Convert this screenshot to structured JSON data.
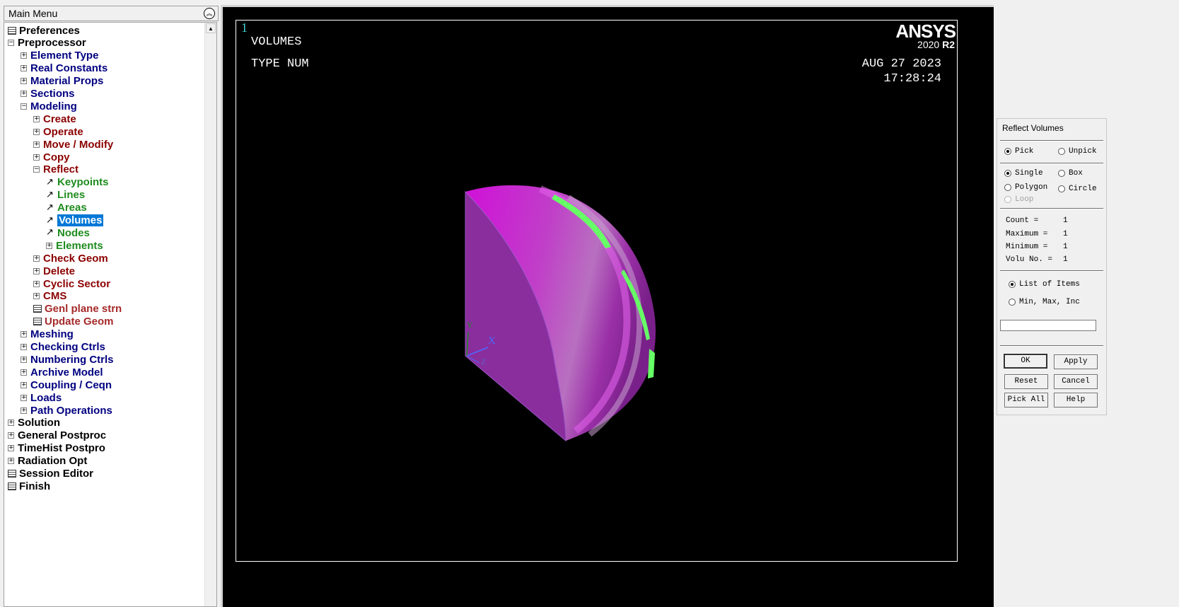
{
  "menu": {
    "title": "Main Menu",
    "items": [
      {
        "label": "Preferences",
        "level": 0,
        "icon": "calc",
        "color": "black"
      },
      {
        "label": "Preprocessor",
        "level": 0,
        "icon": "minus",
        "color": "black"
      },
      {
        "label": "Element Type",
        "level": 1,
        "icon": "plus",
        "color": "blue"
      },
      {
        "label": "Real Constants",
        "level": 1,
        "icon": "plus",
        "color": "blue"
      },
      {
        "label": "Material Props",
        "level": 1,
        "icon": "plus",
        "color": "blue"
      },
      {
        "label": "Sections",
        "level": 1,
        "icon": "plus",
        "color": "blue"
      },
      {
        "label": "Modeling",
        "level": 1,
        "icon": "minus",
        "color": "blue"
      },
      {
        "label": "Create",
        "level": 2,
        "icon": "plus",
        "color": "red"
      },
      {
        "label": "Operate",
        "level": 2,
        "icon": "plus",
        "color": "red"
      },
      {
        "label": "Move / Modify",
        "level": 2,
        "icon": "plus",
        "color": "red"
      },
      {
        "label": "Copy",
        "level": 2,
        "icon": "plus",
        "color": "red"
      },
      {
        "label": "Reflect",
        "level": 2,
        "icon": "minus",
        "color": "red"
      },
      {
        "label": "Keypoints",
        "level": 3,
        "icon": "arrow",
        "color": "green"
      },
      {
        "label": "Lines",
        "level": 3,
        "icon": "arrow",
        "color": "green"
      },
      {
        "label": "Areas",
        "level": 3,
        "icon": "arrow",
        "color": "green"
      },
      {
        "label": "Volumes",
        "level": 3,
        "icon": "arrow",
        "color": "green",
        "selected": true
      },
      {
        "label": "Nodes",
        "level": 3,
        "icon": "arrow",
        "color": "green"
      },
      {
        "label": "Elements",
        "level": 3,
        "icon": "plus",
        "color": "green"
      },
      {
        "label": "Check Geom",
        "level": 2,
        "icon": "plus",
        "color": "red"
      },
      {
        "label": "Delete",
        "level": 2,
        "icon": "plus",
        "color": "red"
      },
      {
        "label": "Cyclic Sector",
        "level": 2,
        "icon": "plus",
        "color": "red"
      },
      {
        "label": "CMS",
        "level": 2,
        "icon": "plus",
        "color": "red"
      },
      {
        "label": "Genl plane strn",
        "level": 2,
        "icon": "calc",
        "color": "brown"
      },
      {
        "label": "Update Geom",
        "level": 2,
        "icon": "calc",
        "color": "brown"
      },
      {
        "label": "Meshing",
        "level": 1,
        "icon": "plus",
        "color": "blue"
      },
      {
        "label": "Checking Ctrls",
        "level": 1,
        "icon": "plus",
        "color": "blue"
      },
      {
        "label": "Numbering Ctrls",
        "level": 1,
        "icon": "plus",
        "color": "blue"
      },
      {
        "label": "Archive Model",
        "level": 1,
        "icon": "plus",
        "color": "blue"
      },
      {
        "label": "Coupling / Ceqn",
        "level": 1,
        "icon": "plus",
        "color": "blue"
      },
      {
        "label": "Loads",
        "level": 1,
        "icon": "plus",
        "color": "blue"
      },
      {
        "label": "Path Operations",
        "level": 1,
        "icon": "plus",
        "color": "blue"
      },
      {
        "label": "Solution",
        "level": 0,
        "icon": "plus",
        "color": "black"
      },
      {
        "label": "General Postproc",
        "level": 0,
        "icon": "plus",
        "color": "black"
      },
      {
        "label": "TimeHist Postpro",
        "level": 0,
        "icon": "plus",
        "color": "black"
      },
      {
        "label": "Radiation Opt",
        "level": 0,
        "icon": "plus",
        "color": "black"
      },
      {
        "label": "Session Editor",
        "level": 0,
        "icon": "calc",
        "color": "black"
      },
      {
        "label": "Finish",
        "level": 0,
        "icon": "calc",
        "color": "black"
      }
    ]
  },
  "graphics": {
    "window_number": "1",
    "plot_label": "VOLUMES",
    "type_label": "TYPE NUM",
    "date": "AUG 27 2023",
    "time": "17:28:24",
    "logo": "ANSYS",
    "version": "2020",
    "release": "R2",
    "axis_x_label": "X",
    "axis_y_label": "Y",
    "axis_z_label": "Z"
  },
  "picker": {
    "title": "Reflect Volumes",
    "pick": "Pick",
    "unpick": "Unpick",
    "single": "Single",
    "box": "Box",
    "polygon": "Polygon",
    "circle": "Circle",
    "loop": "Loop",
    "count_label": "Count    =",
    "count_value": "1",
    "maximum_label": "Maximum  =",
    "maximum_value": "1",
    "minimum_label": "Minimum  =",
    "minimum_value": "1",
    "volu_label": "Volu No. =",
    "volu_value": "1",
    "list_of_items": "List of Items",
    "min_max_inc": "Min, Max, Inc",
    "input_value": "",
    "buttons": {
      "ok": "OK",
      "apply": "Apply",
      "reset": "Reset",
      "cancel": "Cancel",
      "pick_all": "Pick All",
      "help": "Help"
    }
  },
  "colors": {
    "volume_face": "#8a2e9e",
    "volume_surface": "#d010d8",
    "highlight_edge": "#66ff66",
    "window_number": "#3fd3d3",
    "selection": "#0078d7"
  }
}
